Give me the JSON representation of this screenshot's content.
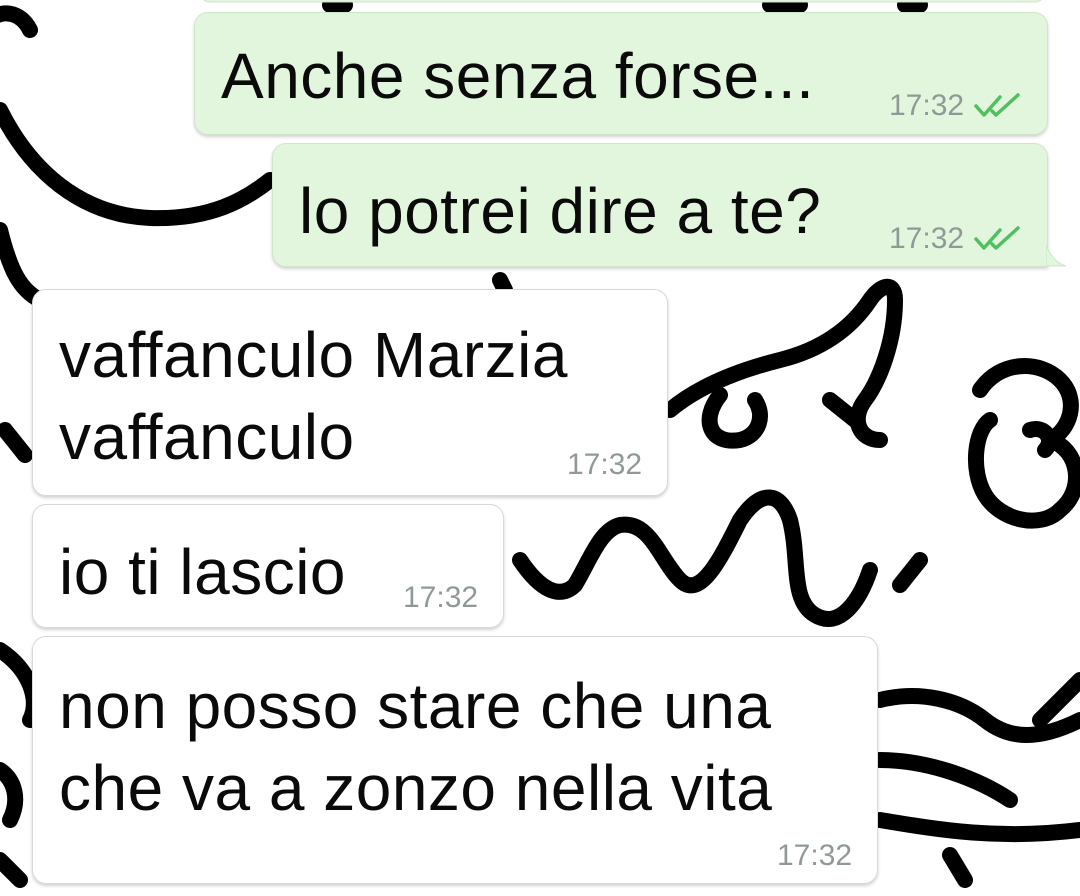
{
  "conversation": {
    "messages": [
      {
        "direction": "outgoing",
        "text": "Anche senza forse...",
        "time": "17:32",
        "status": "read"
      },
      {
        "direction": "outgoing",
        "text": "lo potrei dire a te?",
        "time": "17:32",
        "status": "read"
      },
      {
        "direction": "incoming",
        "lines": [
          "vaffanculo Marzia",
          "vaffanculo"
        ],
        "time": "17:32"
      },
      {
        "direction": "incoming",
        "text": "io ti lascio",
        "time": "17:32"
      },
      {
        "direction": "incoming",
        "lines": [
          "non posso stare che una",
          "che va a zonzo nella vita"
        ],
        "time": "17:32"
      }
    ]
  },
  "colors": {
    "outgoing_bubble": "#e1f6dd",
    "incoming_bubble": "#ffffff",
    "timestamp": "#8f9a98",
    "read_ticks": "#4fbf60",
    "wallpaper_lines": "#000000"
  },
  "icons": {
    "read_receipt": "double-check-icon"
  }
}
